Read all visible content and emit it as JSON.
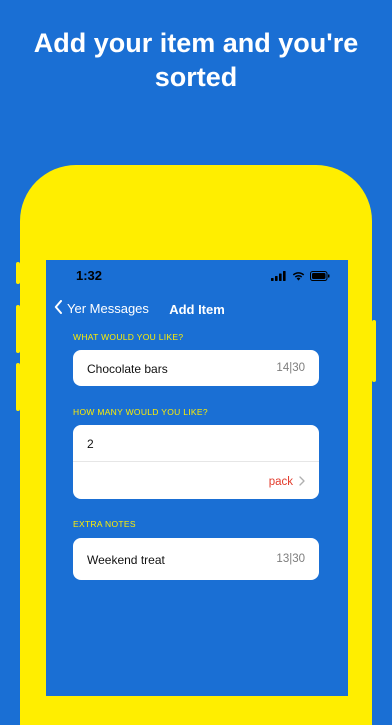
{
  "headline": {
    "line1": "Add your item and you're",
    "line2": "sorted"
  },
  "status_bar": {
    "time": "1:32"
  },
  "nav": {
    "back_label": "Yer Messages",
    "title": "Add Item"
  },
  "item_section": {
    "label": "WHAT WOULD YOU LIKE?",
    "value": "Chocolate bars",
    "counter": "14|30"
  },
  "quantity_section": {
    "label": "HOW MANY WOULD YOU LIKE?",
    "value": "2",
    "unit": "pack"
  },
  "notes_section": {
    "label": "EXTRA NOTES",
    "value": "Weekend treat",
    "counter": "13|30"
  },
  "colors": {
    "background": "#1a6fd4",
    "phone_frame": "#ffee00",
    "section_label": "#ffee00",
    "unit_accent": "#e23b2b"
  },
  "icons": [
    "chevron-left-icon",
    "wifi-icon",
    "battery-icon",
    "chevron-right-icon"
  ]
}
